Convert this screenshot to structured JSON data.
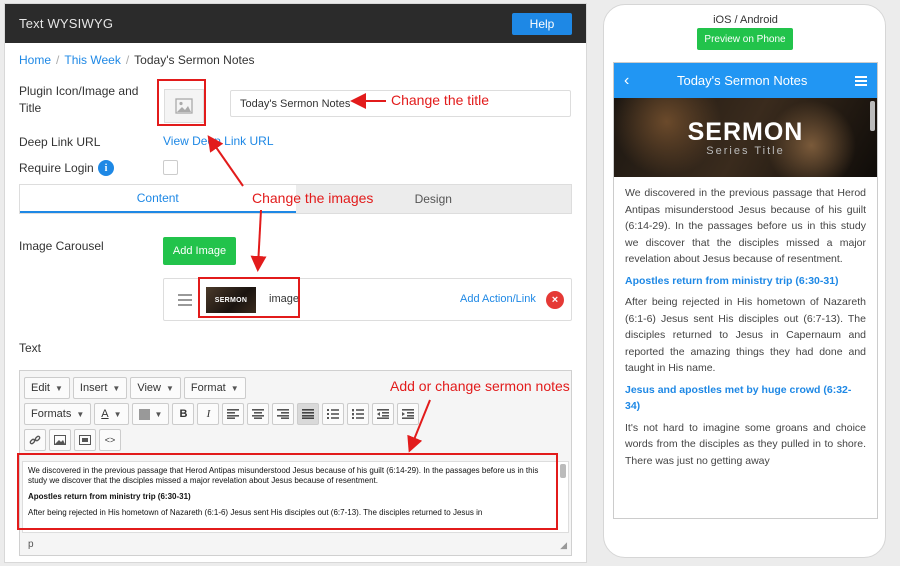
{
  "editor": {
    "header_title": "Text WYSIWYG",
    "help_label": "Help",
    "breadcrumb": {
      "home": "Home",
      "this_week": "This Week",
      "current": "Today's Sermon Notes",
      "sep": "/"
    },
    "plugin_icon_label": "Plugin Icon/Image and Title",
    "title_value": "Today's Sermon Notes",
    "deep_link_label": "Deep Link URL",
    "deep_link_text": "View Deep Link URL",
    "require_login_label": "Require Login",
    "info_glyph": "i",
    "tabs": [
      {
        "label": "Content"
      },
      {
        "label": "Design"
      }
    ],
    "image_carousel_label": "Image Carousel",
    "add_image_label": "Add Image",
    "carousel_item": {
      "thumb_text": "SERMON",
      "label": "image",
      "action_label": "Add Action/Link",
      "remove_glyph": "×"
    },
    "text_label": "Text",
    "toolbar": {
      "menus": [
        "Edit",
        "Insert",
        "View",
        "Format"
      ],
      "formats_label": "Formats",
      "font_color_glyph": "A",
      "bold_glyph": "B",
      "italic_glyph": "I",
      "code_glyph": "<>"
    },
    "content": {
      "para1": "We discovered in the previous passage that Herod Antipas misunderstood Jesus because of his guilt (6:14-29). In the passages before us in this study we discover that the disciples missed a major revelation about Jesus because of resentment.",
      "heading1": "Apostles return from ministry trip (6:30-31)",
      "para2": "After being rejected in His hometown of Nazareth (6:1-6) Jesus sent His disciples out (6:7-13). The disciples returned to Jesus in"
    },
    "status_path": "p"
  },
  "annotations": {
    "change_title": "Change the title",
    "change_images": "Change the images",
    "change_notes": "Add or change sermon notes",
    "color": "#e21b1b"
  },
  "phone": {
    "platform_label": "iOS / Android",
    "preview_label": "Preview on Phone",
    "back_glyph": "‹",
    "app_title": "Today's Sermon Notes",
    "banner_title": "SERMON",
    "banner_sub": "Series Title",
    "body": {
      "para1": "We discovered in the previous passage that Herod Antipas misunderstood Jesus because of his guilt (6:14-29). In the passages before us in this study we discover that the disciples missed a major revelation about Jesus because of resentment.",
      "heading1": "Apostles return from ministry trip (6:30-31)",
      "para2": "After being rejected in His hometown of Nazareth (6:1-6) Jesus sent His disciples out (6:7-13). The disciples returned to Jesus in Capernaum and reported the amazing things they had done and taught in His name.",
      "heading2": "Jesus and apostles met by huge crowd (6:32-34)",
      "para3": "It's not hard to imagine some groans and choice words from the disciples as they pulled in to shore. There was just no getting away"
    }
  },
  "colors": {
    "accent": "#1e88e5",
    "green": "#22c34b",
    "header": "#2b2b2b",
    "danger": "#e53935"
  }
}
